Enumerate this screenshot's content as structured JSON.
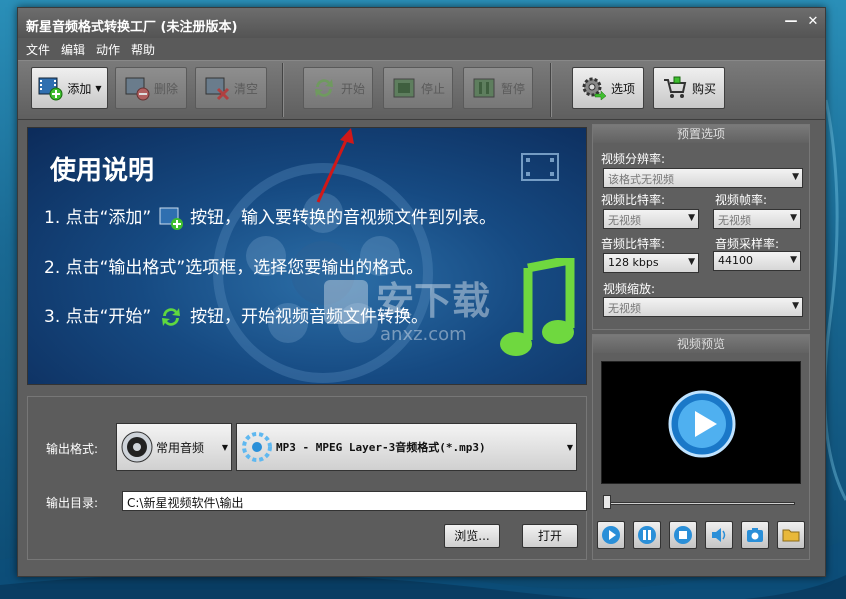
{
  "window": {
    "title": "新星音频格式转换工厂  (未注册版本)",
    "minimize": "—",
    "close": "✕"
  },
  "menu": [
    "文件",
    "编辑",
    "动作",
    "帮助"
  ],
  "toolbar": {
    "add": "添加",
    "delete": "删除",
    "clear": "清空",
    "start": "开始",
    "stop": "停止",
    "pause": "暂停",
    "options": "选项",
    "buy": "购买"
  },
  "banner": {
    "title": "使用说明",
    "step1_a": "1. 点击“添加”",
    "step1_b": "按钮，输入要转换的音视频文件到列表。",
    "step2": "2. 点击“输出格式”选项框，选择您要输出的格式。",
    "step3_a": "3. 点击“开始”",
    "step3_b": "按钮，开始视频音频文件转换。",
    "watermark": "安下载",
    "watermark2": "anxz.com"
  },
  "output": {
    "format_label": "输出格式:",
    "category": "常用音频",
    "format": "MP3 - MPEG Layer-3音频格式(*.mp3)",
    "dir_label": "输出目录:",
    "dir_value": "C:\\新星视频软件\\输出",
    "browse": "浏览...",
    "open": "打开"
  },
  "presets": {
    "title": "预置选项",
    "resolution_label": "视频分辨率:",
    "resolution_value": "该格式无视频",
    "vbitrate_label": "视频比特率:",
    "vbitrate_value": "无视频",
    "fps_label": "视频帧率:",
    "fps_value": "无视频",
    "abitrate_label": "音频比特率:",
    "abitrate_value": "128 kbps",
    "samplerate_label": "音频采样率:",
    "samplerate_value": "44100",
    "scale_label": "视频缩放:",
    "scale_value": "无视频"
  },
  "preview": {
    "title": "视频预览",
    "seek_fraction": 0.0
  },
  "colors": {
    "window_bg": "#5e5e5e",
    "toolbar_btn": "#e0e0e0",
    "accent_green": "#3fbf2f",
    "accent_blue": "#2a8fd8",
    "arrow_red": "#d01818"
  }
}
